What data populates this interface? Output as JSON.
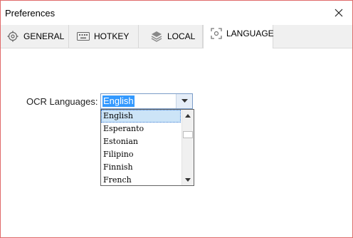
{
  "window": {
    "title": "Preferences"
  },
  "tabs": [
    {
      "label": "GENERAL",
      "icon": "gear-icon"
    },
    {
      "label": "HOTKEY",
      "icon": "keyboard-icon"
    },
    {
      "label": "LOCAL",
      "icon": "layers-icon"
    },
    {
      "label": "LANGUAGE",
      "icon": "scan-frame-icon",
      "active": true
    }
  ],
  "ocr": {
    "label": "OCR Languages:",
    "selected_value": "English",
    "options": [
      "English",
      "Esperanto",
      "Estonian",
      "Filipino",
      "Finnish",
      "French"
    ]
  },
  "colors": {
    "selection_highlight": "#3399ff",
    "list_selected_bg": "#cce4f7",
    "window_border": "#e06a6a"
  }
}
